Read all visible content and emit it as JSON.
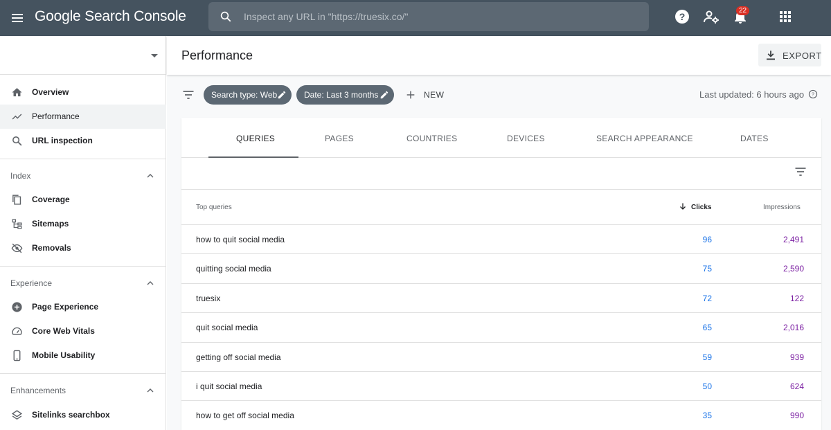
{
  "app": {
    "brand": "Google Search Console"
  },
  "search": {
    "placeholder": "Inspect any URL in \"https://truesix.co/\""
  },
  "notifications": {
    "count": "22"
  },
  "sidebar": {
    "items": [
      {
        "label": "Overview",
        "icon": "home-icon"
      },
      {
        "label": "Performance",
        "icon": "trending-up-icon"
      },
      {
        "label": "URL inspection",
        "icon": "search-icon"
      }
    ],
    "sections": [
      {
        "title": "Index",
        "items": [
          {
            "label": "Coverage",
            "icon": "copy-icon"
          },
          {
            "label": "Sitemaps",
            "icon": "sitemap-icon"
          },
          {
            "label": "Removals",
            "icon": "visibility-off-icon"
          }
        ]
      },
      {
        "title": "Experience",
        "items": [
          {
            "label": "Page Experience",
            "icon": "plus-circle-icon"
          },
          {
            "label": "Core Web Vitals",
            "icon": "speed-icon"
          },
          {
            "label": "Mobile Usability",
            "icon": "smartphone-icon"
          }
        ]
      },
      {
        "title": "Enhancements",
        "items": [
          {
            "label": "Sitelinks searchbox",
            "icon": "layers-icon"
          }
        ]
      }
    ]
  },
  "header": {
    "title": "Performance",
    "export_label": "EXPORT"
  },
  "filters": {
    "chips": [
      "Search type: Web",
      "Date: Last 3 months"
    ],
    "new_label": "NEW",
    "last_updated": "Last updated: 6 hours ago"
  },
  "tabs": [
    "QUERIES",
    "PAGES",
    "COUNTRIES",
    "DEVICES",
    "SEARCH APPEARANCE",
    "DATES"
  ],
  "table": {
    "headers": {
      "query": "Top queries",
      "clicks": "Clicks",
      "impressions": "Impressions"
    },
    "rows": [
      {
        "query": "how to quit social media",
        "clicks": "96",
        "impressions": "2,491"
      },
      {
        "query": "quitting social media",
        "clicks": "75",
        "impressions": "2,590"
      },
      {
        "query": "truesix",
        "clicks": "72",
        "impressions": "122"
      },
      {
        "query": "quit social media",
        "clicks": "65",
        "impressions": "2,016"
      },
      {
        "query": "getting off social media",
        "clicks": "59",
        "impressions": "939"
      },
      {
        "query": "i quit social media",
        "clicks": "50",
        "impressions": "624"
      },
      {
        "query": "how to get off social media",
        "clicks": "35",
        "impressions": "990"
      }
    ]
  },
  "colors": {
    "topbar": "#45535f",
    "clicks": "#1a73e8",
    "impressions": "#7b1fa2",
    "badge": "#d93025"
  }
}
